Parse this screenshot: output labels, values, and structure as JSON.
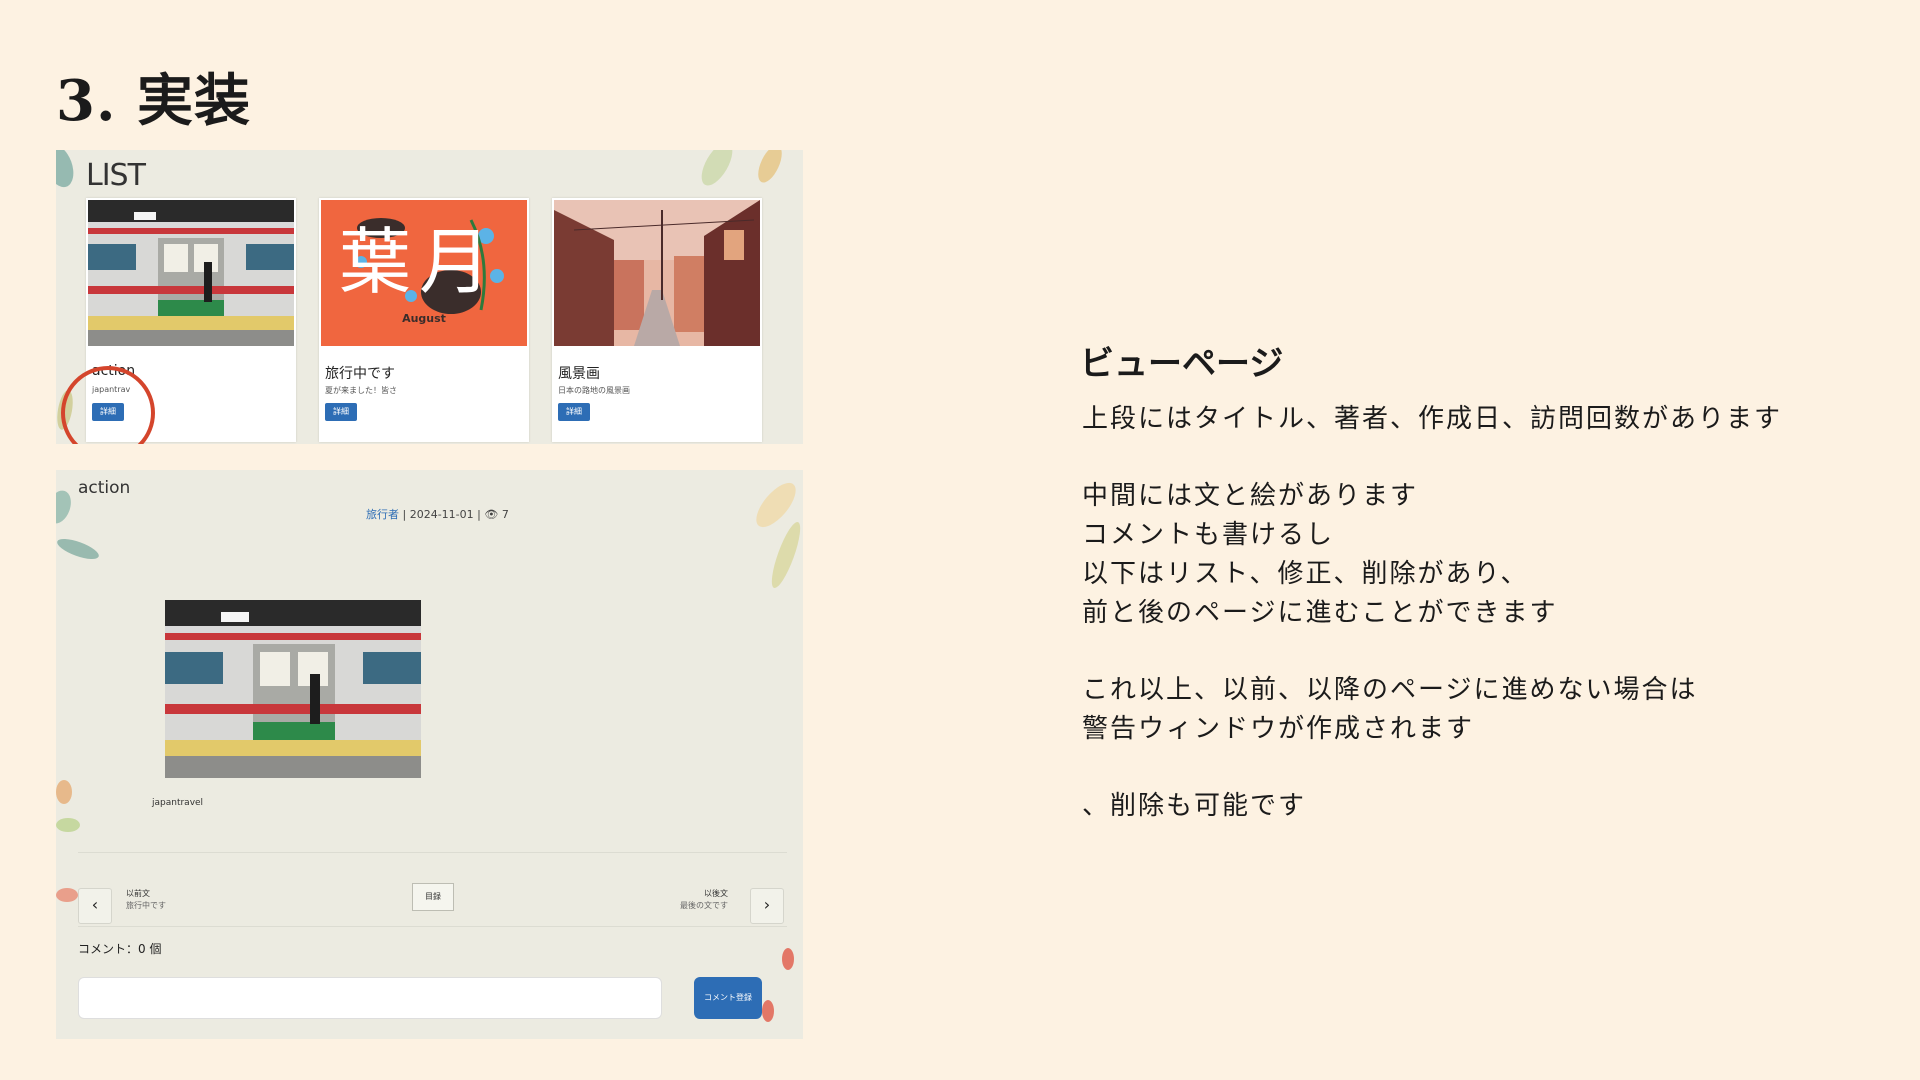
{
  "slide": {
    "title": "3. 実装"
  },
  "list_screen": {
    "heading": "LIST",
    "cards": [
      {
        "title": "action",
        "subtitle": "japantrav",
        "button": "詳細"
      },
      {
        "title": "旅行中です",
        "subtitle": "夏が来ました！皆さ",
        "button": "詳細"
      },
      {
        "title": "風景画",
        "subtitle": "日本の路地の風景画",
        "button": "詳細"
      }
    ],
    "poster_text": "August",
    "poster_kanji": "葉月"
  },
  "view_screen": {
    "title": "action",
    "author": "旅行者",
    "date": "2024-11-01",
    "views": "7",
    "caption": "japantravel",
    "prev_label": "以前文",
    "prev_title": "旅行中です",
    "next_label": "以後文",
    "next_title": "最後の文です",
    "list_button": "目録",
    "comment_count": "コメント：0 個",
    "comment_button": "コメント登録"
  },
  "description": {
    "title": "ビューページ",
    "lines": [
      "上段にはタイトル、著者、作成日、訪問回数があります",
      "中間には文と絵があります",
      "コメントも書けるし",
      "以下はリスト、修正、削除があり、",
      "前と後のページに進むことができます",
      "これ以上、以前、以降のページに進めない場合は",
      "警告ウィンドウが作成されます",
      "、削除も可能です"
    ]
  },
  "colors": {
    "background": "#fdf2e2",
    "button_blue": "#2d6db5",
    "highlight_red": "#d4452c",
    "poster_orange": "#f0663f"
  }
}
